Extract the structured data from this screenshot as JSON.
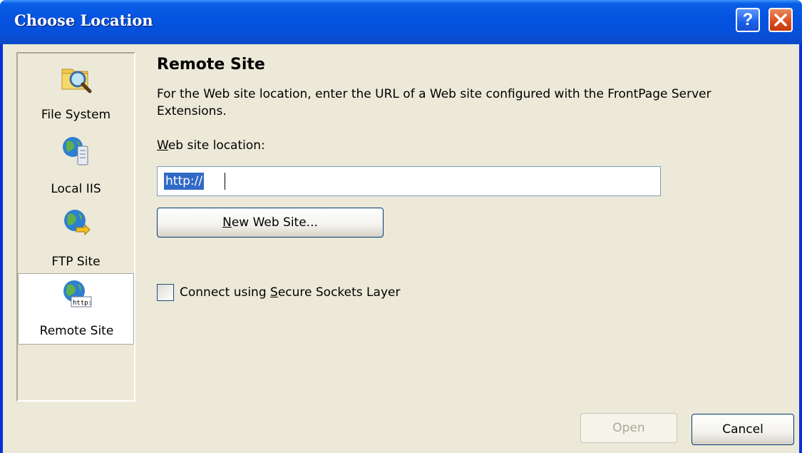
{
  "window": {
    "title": "Choose Location"
  },
  "titlebar_buttons": {
    "help": "?",
    "help_icon": "help-icon",
    "close_icon": "close-icon"
  },
  "nav": {
    "items": [
      {
        "label": "File System",
        "icon": "folder-search-icon",
        "selected": false
      },
      {
        "label": "Local IIS",
        "icon": "local-iis-server-icon",
        "selected": false
      },
      {
        "label": "FTP Site",
        "icon": "ftp-globe-icon",
        "selected": false
      },
      {
        "label": "Remote Site",
        "icon": "remote-site-globe-icon",
        "selected": true
      }
    ]
  },
  "main": {
    "heading": "Remote Site",
    "description": "For the Web site location, enter the URL of a Web site configured with the FrontPage Server Extensions.",
    "location_label_prefix": "W",
    "location_label_rest": "eb site location:",
    "url_value": "http://",
    "new_site_prefix": "N",
    "new_site_rest": "ew Web Site...",
    "ssl_prefix": "Connect using ",
    "ssl_access": "S",
    "ssl_rest": "ecure Sockets Layer",
    "ssl_checked": false
  },
  "footer": {
    "open_label": "Open",
    "cancel_label": "Cancel"
  },
  "colors": {
    "titlebar": "#0553e0",
    "dialog_bg": "#ece9d8",
    "selection": "#316ac5"
  }
}
